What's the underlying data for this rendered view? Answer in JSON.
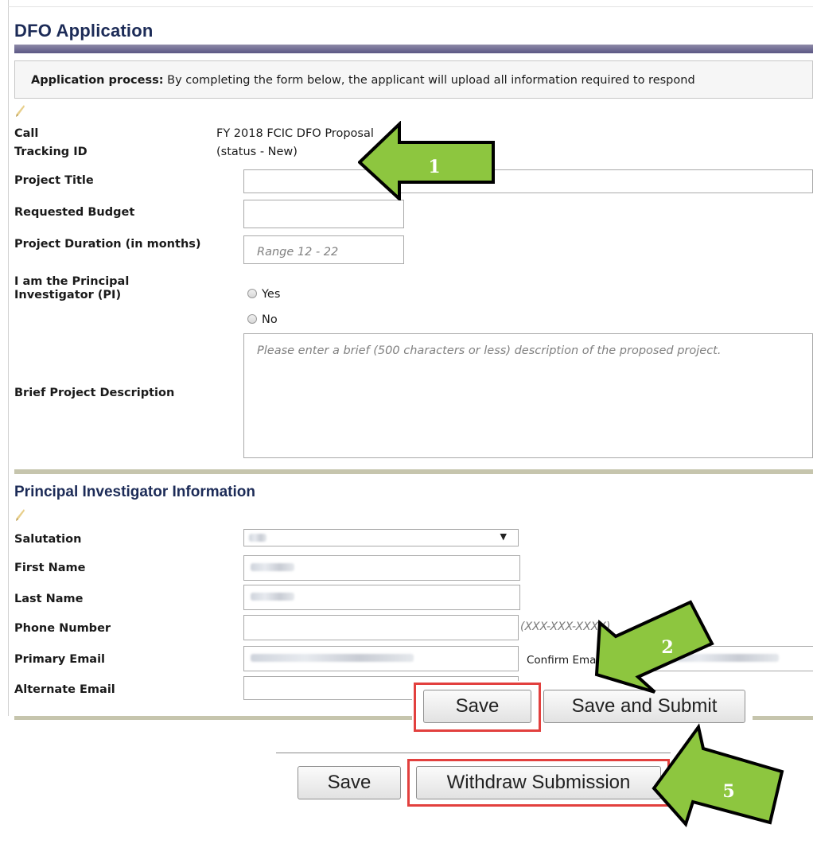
{
  "page": {
    "title": "DFO Application"
  },
  "process": {
    "label": "Application process:",
    "text": " By completing the form below, the applicant will upload all information required to respond"
  },
  "form": {
    "call_label": "Call",
    "call_value": "FY 2018 FCIC DFO Proposal",
    "tracking_label": "Tracking ID",
    "tracking_value": "(status - New)",
    "project_title_label": "Project Title",
    "budget_label": "Requested Budget",
    "duration_label": "Project Duration (in months)",
    "duration_placeholder": "Range 12 - 22",
    "pi_label_line1": "I am the Principal",
    "pi_label_line2": "Investigator (PI)",
    "yes_label": "Yes",
    "no_label": "No",
    "description_label": "Brief Project Description",
    "description_placeholder": "Please enter a brief (500 characters or less) description of the proposed project."
  },
  "pi_section": {
    "title": "Principal Investigator Information",
    "salutation_label": "Salutation",
    "first_name_label": "First Name",
    "last_name_label": "Last Name",
    "phone_label": "Phone Number",
    "phone_hint": "(XXX-XXX-XXXX)",
    "email_label": "Primary Email",
    "confirm_email_label": "Confirm Email",
    "alt_email_label": "Alternate Email"
  },
  "buttons": {
    "save": "Save",
    "save_submit": "Save and Submit",
    "save2": "Save",
    "withdraw": "Withdraw Submission"
  },
  "annotations": {
    "arrow1": "1",
    "arrow2": "2",
    "arrow5": "5"
  },
  "colors": {
    "title": "#1c2b57",
    "arrow_fill": "#8dc63f",
    "highlight": "#e2403e",
    "separator": "#c6c5ad"
  }
}
